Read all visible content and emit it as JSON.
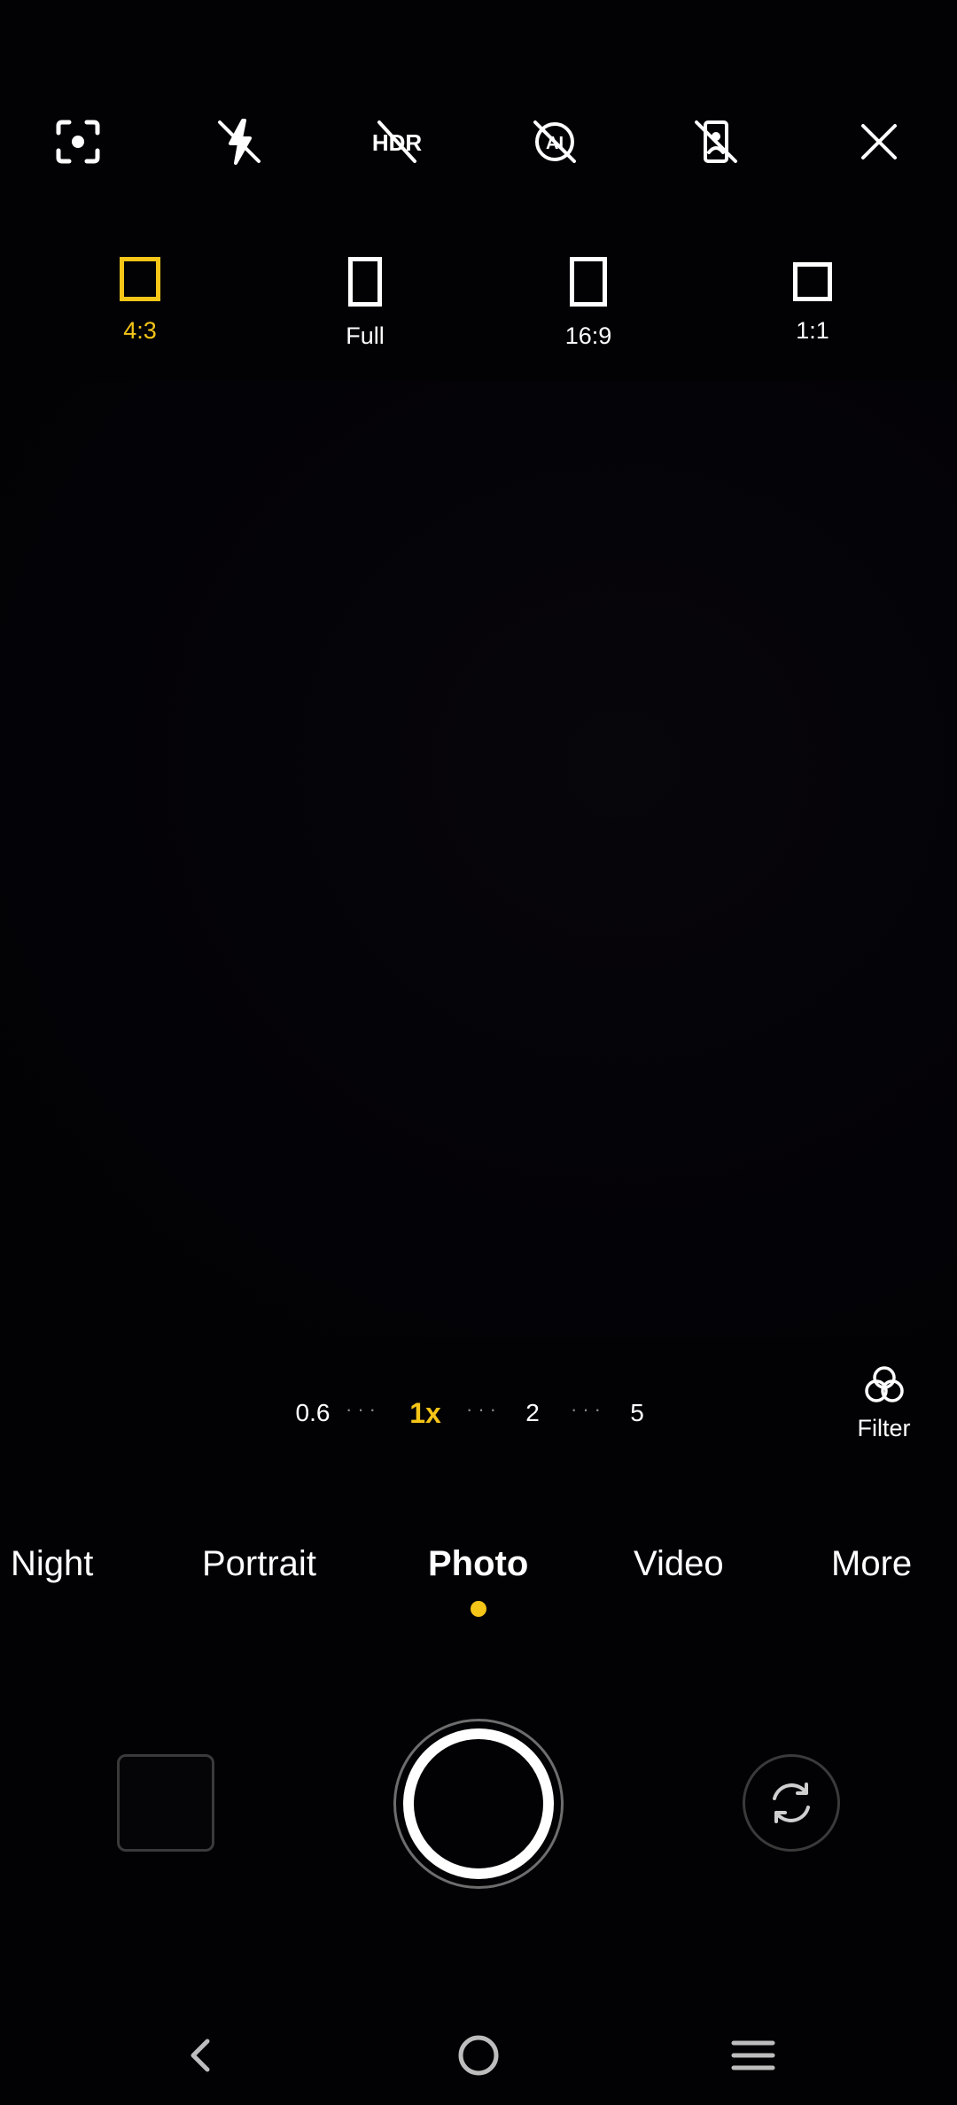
{
  "top_bar": {
    "icons": [
      "focus-scan-icon",
      "flash-off-icon",
      "hdr-off-icon",
      "ai-off-icon",
      "portrait-off-icon",
      "close-icon"
    ]
  },
  "aspect_ratios": [
    {
      "label": "4:3",
      "active": true
    },
    {
      "label": "Full",
      "active": false
    },
    {
      "label": "16:9",
      "active": false
    },
    {
      "label": "1:1",
      "active": false
    }
  ],
  "zoom": {
    "levels": [
      "0.6",
      "1x",
      "2",
      "5"
    ],
    "active": "1x"
  },
  "filter": {
    "label": "Filter"
  },
  "modes": [
    "Night",
    "Portrait",
    "Photo",
    "Video",
    "More"
  ],
  "active_mode": "Photo",
  "colors": {
    "accent": "#f5c518",
    "text": "#ffffff",
    "background": "#020104"
  },
  "nav": {
    "icons": [
      "back-icon",
      "home-icon",
      "recents-icon"
    ]
  }
}
